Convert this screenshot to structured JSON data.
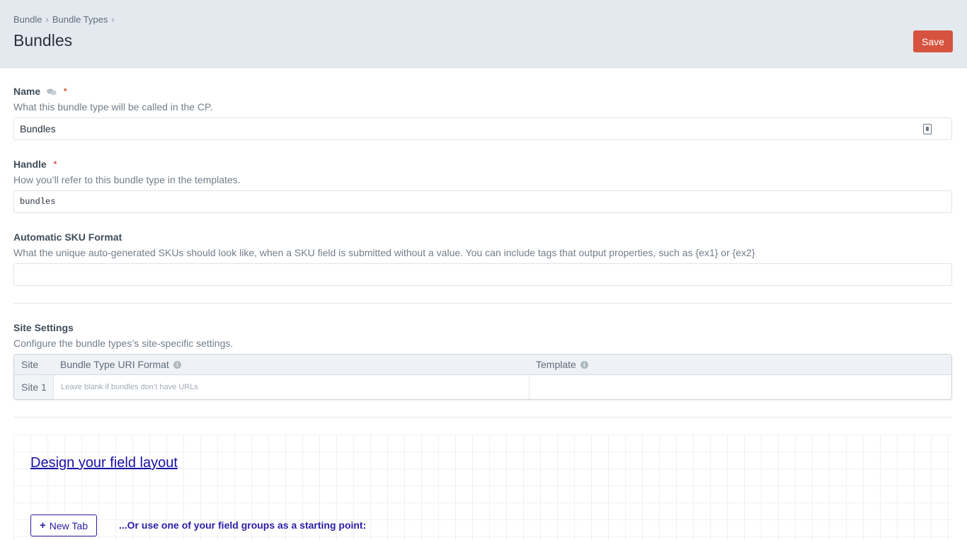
{
  "breadcrumb": [
    "Bundle",
    "Bundle Types"
  ],
  "page_title": "Bundles",
  "save_label": "Save",
  "fields": {
    "name": {
      "label": "Name",
      "required_mark": "*",
      "help": "What this bundle type will be called in the CP.",
      "value": "Bundles"
    },
    "handle": {
      "label": "Handle",
      "required_mark": "*",
      "help": "How you’ll refer to this bundle type in the templates.",
      "value": "bundles"
    },
    "sku_format": {
      "label": "Automatic SKU Format",
      "help": "What the unique auto-generated SKUs should look like, when a SKU field is submitted without a value. You can include tags that output properties, such as {ex1} or {ex2}",
      "value": ""
    }
  },
  "site_settings": {
    "label": "Site Settings",
    "help": "Configure the bundle types’s site-specific settings.",
    "columns": {
      "site": "Site",
      "uri_format": "Bundle Type URI Format",
      "template": "Template"
    },
    "rows": [
      {
        "site": "Site 1",
        "uri_placeholder": "Leave blank if bundles don’t have URLs",
        "template": ""
      }
    ]
  },
  "field_layout": {
    "design_link": "Design your field layout",
    "new_tab_label": "New Tab",
    "field_groups_note": "...Or use one of your field groups as a starting point:"
  },
  "colors": {
    "accent": "#d5533f",
    "link": "#1a10a8",
    "header_bg": "#e4e9ef"
  }
}
